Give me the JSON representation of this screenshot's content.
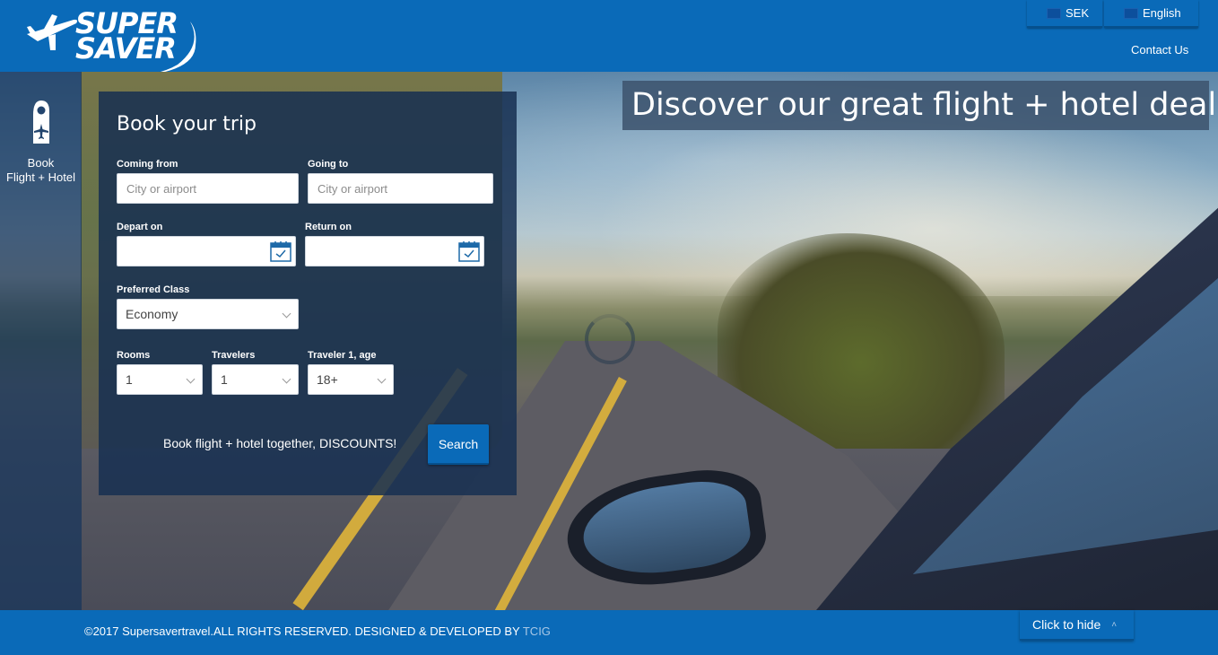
{
  "header": {
    "logo_text_line1": "SUPER",
    "logo_text_line2": "SAVER",
    "currency_label": "SEK",
    "language_label": "English",
    "contact_label": "Contact Us"
  },
  "hero": {
    "headline": "Discover our great flight + hotel deals"
  },
  "sidenav": {
    "items": [
      {
        "icon": "door-hanger-plane-icon",
        "label_line1": "Book",
        "label_line2": "Flight + Hotel"
      }
    ]
  },
  "booking": {
    "title": "Book your trip",
    "coming_from": {
      "label": "Coming from",
      "placeholder": "City or airport",
      "value": ""
    },
    "going_to": {
      "label": "Going to",
      "placeholder": "City or airport",
      "value": ""
    },
    "depart_on": {
      "label": "Depart on",
      "value": ""
    },
    "return_on": {
      "label": "Return on",
      "value": ""
    },
    "preferred_class": {
      "label": "Preferred Class",
      "value": "Economy"
    },
    "rooms": {
      "label": "Rooms",
      "value": "1"
    },
    "travelers": {
      "label": "Travelers",
      "value": "1"
    },
    "traveler_age": {
      "label": "Traveler 1, age",
      "value": "18+"
    },
    "promo_text": "Book flight + hotel together, DISCOUNTS!",
    "search_label": "Search"
  },
  "footer": {
    "copyright": "©2017 Supersavertravel.ALL RIGHTS RESERVED. DESIGNED & DEVELOPED BY ",
    "developer": "TCIG",
    "hide_label": "Click to hide"
  },
  "colors": {
    "brand_blue": "#0a6ab8",
    "panel_bg": "#173052",
    "accent_link": "#a9c8e6"
  }
}
